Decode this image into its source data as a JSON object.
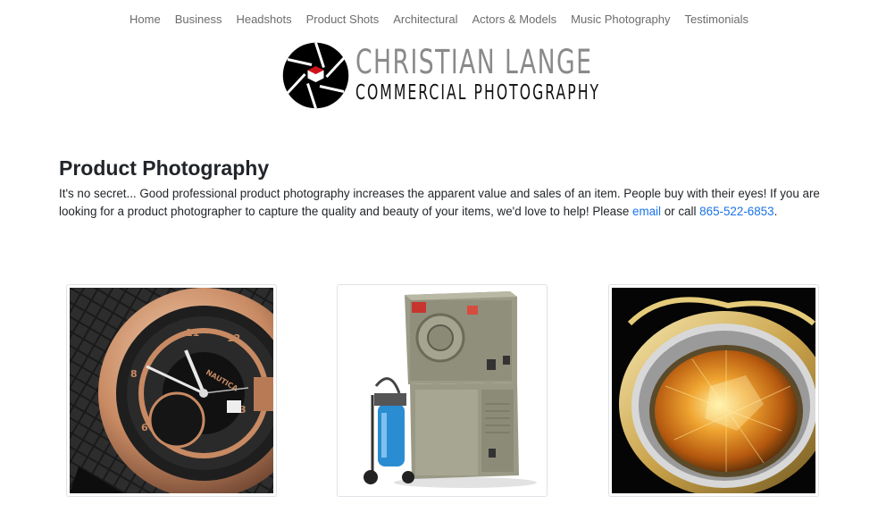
{
  "nav": {
    "items": [
      "Home",
      "Business",
      "Headshots",
      "Product Shots",
      "Architectural",
      "Actors & Models",
      "Music Photography",
      "Testimonials"
    ]
  },
  "logo": {
    "line1": "CHRISTIAN LANGE",
    "line2": "COMMERCIAL PHOTOGRAPHY",
    "mark_color": "#000000",
    "accent_color": "#d0121b"
  },
  "main": {
    "title": "Product Photography",
    "intro_text": "It's no secret... Good professional product photography increases the apparent value and sales of an item. People buy with their eyes! If you are looking for a product photographer to capture the quality and beauty of your items, we'd love to help! Please ",
    "email_link": "email",
    "middle_text": " or call ",
    "phone_link": "865-522-6853",
    "end_text": "."
  },
  "gallery": {
    "items": [
      {
        "subject": "watch",
        "dial_text": "NAUTICA"
      },
      {
        "subject": "sterilizer machine"
      },
      {
        "subject": "ring"
      }
    ]
  },
  "colors": {
    "nav_text": "#6c6c6c",
    "link": "#1a73e8",
    "heading": "#212529",
    "logo_grey": "#8a8a8a"
  }
}
